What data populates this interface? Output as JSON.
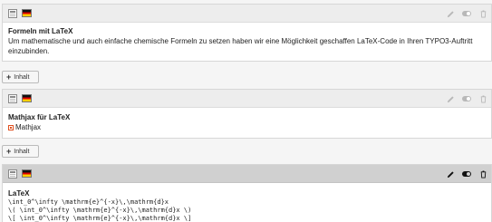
{
  "elements": [
    {
      "title": "Formeln mit LaTeX",
      "text": "Um mathematische und auch einfache chemische Formeln zu setzen haben wir eine Möglichkeit geschaffen LaTeX-Code in Ihren TYPO3-Auftritt einzubinden."
    },
    {
      "title": "Mathjax für LaTeX",
      "text": "Mathjax"
    },
    {
      "title": "LaTeX",
      "code": [
        "\\int_0^\\infty \\mathrm{e}^{-x}\\,\\mathrm{d}x",
        "\\( \\int_0^\\infty \\mathrm{e}^{-x}\\,\\mathrm{d}x \\)",
        "\\[ \\int_0^\\infty \\mathrm{e}^{-x}\\,\\mathrm{d}x \\]"
      ]
    }
  ],
  "add_button_label": "Inhalt",
  "icons": {
    "content_type": "content-type-icon",
    "language": "german-flag-icon",
    "edit": "pencil-icon",
    "toggle": "toggle-visibility-icon",
    "delete": "trash-icon"
  },
  "colors": {
    "flag": [
      "#000000",
      "#dd0000",
      "#ffce00"
    ],
    "header": "#ededed",
    "header_active": "#d0d0d0"
  }
}
